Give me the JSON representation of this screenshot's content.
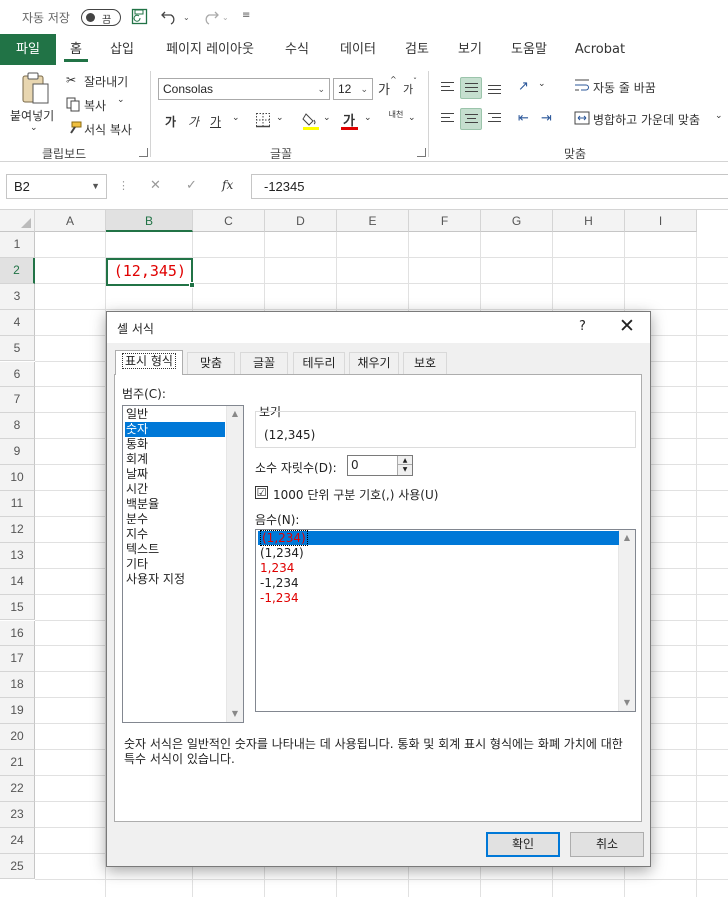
{
  "titlebar": {
    "autosave_label": "자동 저장",
    "toggle_label": "끔"
  },
  "ribbon_tabs": [
    "파일",
    "홈",
    "삽입",
    "페이지 레이아웃",
    "수식",
    "데이터",
    "검토",
    "보기",
    "도움말",
    "Acrobat"
  ],
  "ribbon": {
    "clipboard": {
      "paste": "붙여넣기",
      "cut": "잘라내기",
      "copy": "복사",
      "format_painter": "서식 복사",
      "group": "클립보드"
    },
    "font": {
      "name": "Consolas",
      "size": "12",
      "bold": "가",
      "italic": "가",
      "underline": "가",
      "font_color_glyph": "가",
      "phonetic": "내천",
      "grow": "가",
      "shrink": "가",
      "group": "글꼴"
    },
    "alignment": {
      "wrap": "자동 줄 바꿈",
      "merge": "병합하고 가운데 맞춤",
      "group": "맞춤"
    }
  },
  "formula_bar": {
    "name_box": "B2",
    "fx": "fx",
    "value": "-12345",
    "cancel": "✕",
    "enter": "✓"
  },
  "sheet": {
    "columns": [
      "A",
      "B",
      "C",
      "D",
      "E",
      "F",
      "G",
      "H",
      "I"
    ],
    "rows": [
      "1",
      "2",
      "3",
      "4",
      "5",
      "6",
      "7",
      "8",
      "9",
      "10",
      "11",
      "12",
      "13",
      "14",
      "15",
      "16",
      "17",
      "18",
      "19",
      "20",
      "21",
      "22",
      "23",
      "24",
      "25"
    ],
    "selected_col": "B",
    "selected_row": "2",
    "active_cell_display": "(12,345)"
  },
  "dialog": {
    "title": "셀 서식",
    "help": "?",
    "close": "✕",
    "tabs": [
      "표시 형식",
      "맞춤",
      "글꼴",
      "테두리",
      "채우기",
      "보호"
    ],
    "category_label": "범주(C):",
    "categories": [
      "일반",
      "숫자",
      "통화",
      "회계",
      "날짜",
      "시간",
      "백분율",
      "분수",
      "지수",
      "텍스트",
      "기타",
      "사용자 지정"
    ],
    "selected_category": "숫자",
    "sample_label": "보기",
    "sample_value": "(12,345)",
    "decimal_label": "소수 자릿수(D):",
    "decimal_value": "0",
    "thousands_label": "1000 단위 구분 기호(,) 사용(U)",
    "thousands_checked": "☑",
    "negative_label": "음수(N):",
    "negative_options": [
      {
        "text": "(1,234)",
        "color": "#e00000",
        "selected": true
      },
      {
        "text": "(1,234)",
        "color": "#222222",
        "selected": false
      },
      {
        "text": "1,234",
        "color": "#e00000",
        "selected": false
      },
      {
        "text": "-1,234",
        "color": "#222222",
        "selected": false
      },
      {
        "text": "-1,234",
        "color": "#e00000",
        "selected": false
      }
    ],
    "description": "숫자 서식은 일반적인 숫자를 나타내는 데 사용됩니다. 통화 및 회계 표시 형식에는 화폐 가치에 대한 특수 서식이 있습니다.",
    "ok": "확인",
    "cancel": "취소"
  },
  "colors": {
    "excel_green": "#217346",
    "selection_blue": "#0078d7",
    "negative_red": "#e00000"
  }
}
